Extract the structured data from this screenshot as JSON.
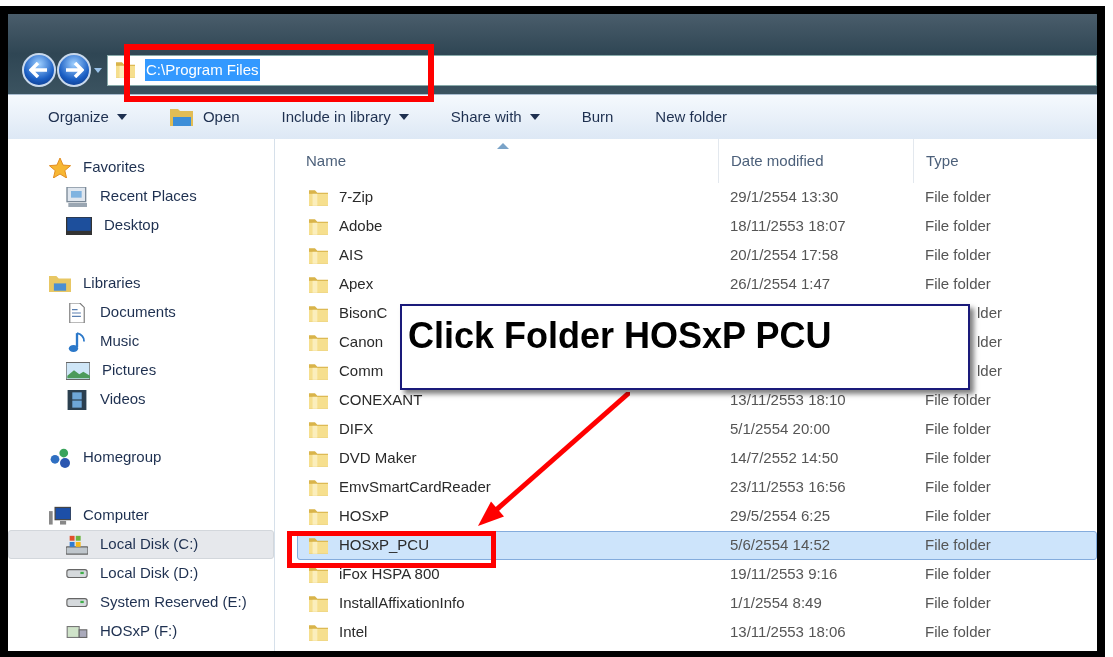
{
  "address": {
    "value": "C:\\Program Files",
    "text_selected": true
  },
  "toolbar": [
    {
      "label": "Organize",
      "kind": "plain",
      "dropdown": true
    },
    {
      "label": "Open",
      "kind": "open",
      "dropdown": false
    },
    {
      "label": "Include in library",
      "kind": "plain",
      "dropdown": true
    },
    {
      "label": "Share with",
      "kind": "plain",
      "dropdown": true
    },
    {
      "label": "Burn",
      "kind": "plain",
      "dropdown": false
    },
    {
      "label": "New folder",
      "kind": "plain",
      "dropdown": false
    }
  ],
  "sidebar": [
    {
      "label": "Favorites",
      "kind": "star",
      "children": [
        {
          "label": "Recent Places",
          "kind": "recent",
          "selected": false
        },
        {
          "label": "Desktop",
          "kind": "desktop",
          "selected": false
        }
      ]
    },
    {
      "label": "Libraries",
      "kind": "library",
      "children": [
        {
          "label": "Documents",
          "kind": "document",
          "selected": false
        },
        {
          "label": "Music",
          "kind": "music",
          "selected": false
        },
        {
          "label": "Pictures",
          "kind": "pictures",
          "selected": false
        },
        {
          "label": "Videos",
          "kind": "video",
          "selected": false
        }
      ]
    },
    {
      "label": "Homegroup",
      "kind": "homegroup"
    },
    {
      "label": "Computer",
      "kind": "computer",
      "children": [
        {
          "label": "Local Disk (C:)",
          "kind": "system-disk",
          "selected": true
        },
        {
          "label": "Local Disk (D:)",
          "kind": "disk",
          "selected": false
        },
        {
          "label": "System Reserved (E:)",
          "kind": "disk",
          "selected": false
        },
        {
          "label": "HOSxP (F:)",
          "kind": "network-disk",
          "selected": false
        }
      ]
    }
  ],
  "columns": [
    {
      "label": "Name",
      "sorted": true
    },
    {
      "label": "Date modified",
      "sorted": false
    },
    {
      "label": "Type",
      "sorted": false
    }
  ],
  "files": [
    {
      "name": "7-Zip",
      "date": "29/1/2554 13:30",
      "type": "File folder",
      "covered": false,
      "selected": false
    },
    {
      "name": "Adobe",
      "date": "18/11/2553 18:07",
      "type": "File folder",
      "covered": false,
      "selected": false
    },
    {
      "name": "AIS",
      "date": "20/1/2554 17:58",
      "type": "File folder",
      "covered": false,
      "selected": false
    },
    {
      "name": "Apex",
      "date": "26/1/2554 1:47",
      "type": "File folder",
      "covered": false,
      "selected": false
    },
    {
      "name": "BisonC",
      "type": "lder",
      "covered": true,
      "selected": false
    },
    {
      "name": "Canon",
      "type": "lder",
      "covered": true,
      "selected": false
    },
    {
      "name": "Comm",
      "type": "lder",
      "covered": true,
      "selected": false
    },
    {
      "name": "CONEXANT",
      "date": "13/11/2553 18:10",
      "type": "File folder",
      "covered": false,
      "selected": false
    },
    {
      "name": "DIFX",
      "date": "5/1/2554 20:00",
      "type": "File folder",
      "covered": false,
      "selected": false
    },
    {
      "name": "DVD Maker",
      "date": "14/7/2552 14:50",
      "type": "File folder",
      "covered": false,
      "selected": false
    },
    {
      "name": "EmvSmartCardReader",
      "date": "23/11/2553 16:56",
      "type": "File folder",
      "covered": false,
      "selected": false
    },
    {
      "name": "HOSxP",
      "date": "29/5/2554 6:25",
      "type": "File folder",
      "covered": false,
      "selected": false
    },
    {
      "name": "HOSxP_PCU",
      "date": "5/6/2554 14:52",
      "type": "File folder",
      "covered": false,
      "selected": true
    },
    {
      "name": "iFox HSPA 800",
      "date": "19/11/2553 9:16",
      "type": "File folder",
      "covered": false,
      "selected": false
    },
    {
      "name": "InstallAffixationInfo",
      "date": "1/1/2554 8:49",
      "type": "File folder",
      "covered": false,
      "selected": false
    },
    {
      "name": "Intel",
      "date": "13/11/2553 18:06",
      "type": "File folder",
      "covered": false,
      "selected": false
    }
  ],
  "callout": {
    "text": "Click Folder HOSxP PCU"
  }
}
